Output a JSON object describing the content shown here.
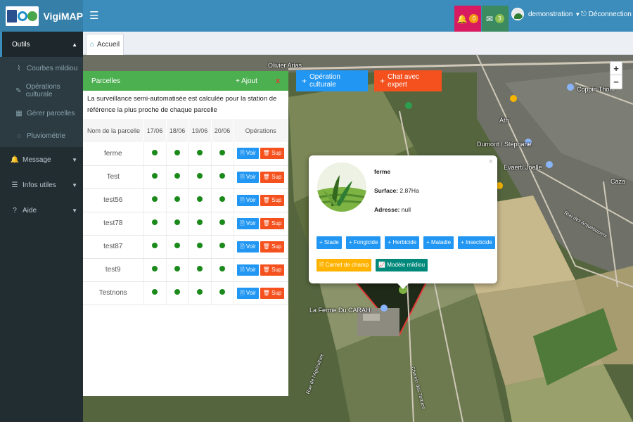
{
  "app": {
    "name": "VigiMAP"
  },
  "header": {
    "notifications_count": "0",
    "messages_count": "3",
    "username": "demonstration",
    "logout_label": "Déconnection"
  },
  "sidebar": {
    "items": [
      {
        "label": "Outils",
        "icon": "wrench-icon"
      },
      {
        "label": "Courbes mildiou",
        "icon": "chart-line-icon"
      },
      {
        "label": "Opérations culturale",
        "icon": "edit-icon"
      },
      {
        "label": "Gérer parcelles",
        "icon": "map-icon"
      },
      {
        "label": "Pluviométrie",
        "icon": "droplet-icon"
      },
      {
        "label": "Message",
        "icon": "bell-icon"
      },
      {
        "label": "Infos utiles",
        "icon": "list-icon"
      },
      {
        "label": "Aide",
        "icon": "question-icon"
      }
    ]
  },
  "tabs": [
    {
      "label": "Accueil"
    }
  ],
  "map": {
    "labels": [
      "Olivier Arias",
      "Coppin Thom",
      "Dumont / Stéphane",
      "Evaert/ Joelle",
      "Ath",
      "Caza",
      "La Ferme Du CARAH",
      "Rue des Arquebusiers",
      "Rue de l'Agriculture",
      "Chemin des Tortues"
    ],
    "zoom_in": "+",
    "zoom_out": "−",
    "btn_operation": "Opération culturale",
    "btn_chat": "Chat avec expert"
  },
  "panel": {
    "title": "Parcelles",
    "add_label": "Ajout",
    "close_label": "x",
    "note": "La surveillance semi-automatisée est calculée pour la station de référence la plus proche de chaque parcelle",
    "columns": [
      "Nom de la parcelle",
      "17/06",
      "18/06",
      "19/06",
      "20/06",
      "Opérations"
    ],
    "rows": [
      {
        "name": "ferme"
      },
      {
        "name": "Test"
      },
      {
        "name": "test56"
      },
      {
        "name": "test78"
      },
      {
        "name": "test87"
      },
      {
        "name": "test9"
      },
      {
        "name": "Testnons"
      }
    ],
    "voir_label": "Voir",
    "sup_label": "Sup"
  },
  "popup": {
    "name": "ferme",
    "surface_label": "Surface:",
    "surface_value": "2.87Ha",
    "adresse_label": "Adresse:",
    "adresse_value": "null",
    "close": "×",
    "actions": [
      "Stade",
      "Fongicide",
      "Herbicide",
      "Maladie",
      "Insecticide"
    ],
    "carnet_label": "Carnet de champ",
    "modele_label": "Modèle mildiou"
  },
  "colors": {
    "header": "#3c8dbc",
    "sidebar": "#222d32",
    "panel_header": "#4caf50",
    "primary_button": "#2196f3",
    "danger_button": "#f4511e",
    "status_dot": "#1b8a1b"
  }
}
